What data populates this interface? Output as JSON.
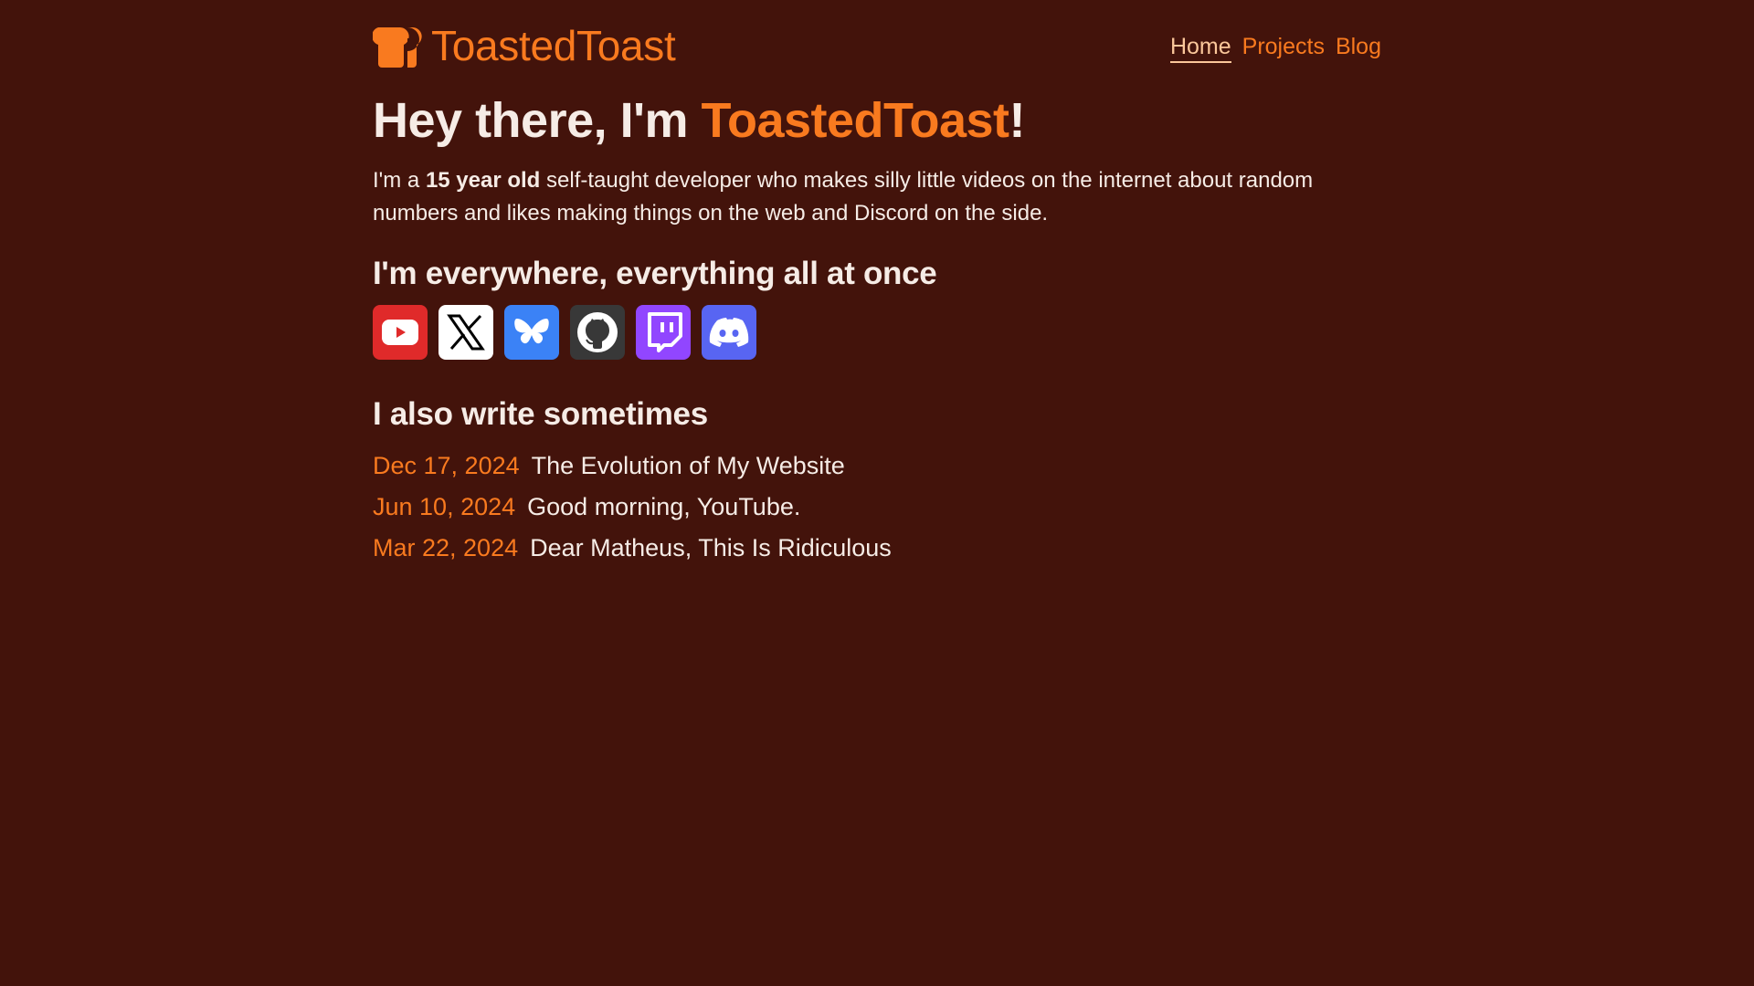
{
  "site": {
    "name": "ToastedToast",
    "logo_icon": "toast-bread-icon",
    "accent_color": "#f97a1f",
    "background_color": "#43130b"
  },
  "nav": {
    "items": [
      {
        "label": "Home",
        "active": true
      },
      {
        "label": "Projects",
        "active": false
      },
      {
        "label": "Blog",
        "active": false
      }
    ]
  },
  "hero": {
    "title_prefix": "Hey there, I'm ",
    "title_name": "ToastedToast",
    "title_suffix": "!",
    "intro_prefix": "I'm a ",
    "intro_bold": "15 year old",
    "intro_suffix": " self-taught developer who makes silly little videos on the internet about random numbers and likes making things on the web and Discord on the side."
  },
  "social": {
    "heading": "I'm everywhere, everything all at once",
    "links": [
      {
        "icon": "youtube-icon",
        "color": "#e02a2a"
      },
      {
        "icon": "x-twitter-icon",
        "color": "#ffffff"
      },
      {
        "icon": "bluesky-butterfly-icon",
        "color": "#3b82f6"
      },
      {
        "icon": "github-icon",
        "color": "#383838"
      },
      {
        "icon": "twitch-icon",
        "color": "#9146ff"
      },
      {
        "icon": "discord-icon",
        "color": "#5865f2"
      }
    ]
  },
  "blog": {
    "heading": "I also write sometimes",
    "posts": [
      {
        "date": "Dec 17, 2024",
        "title": "The Evolution of My Website"
      },
      {
        "date": "Jun 10, 2024",
        "title": "Good morning, YouTube."
      },
      {
        "date": "Mar 22, 2024",
        "title": "Dear Matheus, This Is Ridiculous"
      }
    ]
  }
}
